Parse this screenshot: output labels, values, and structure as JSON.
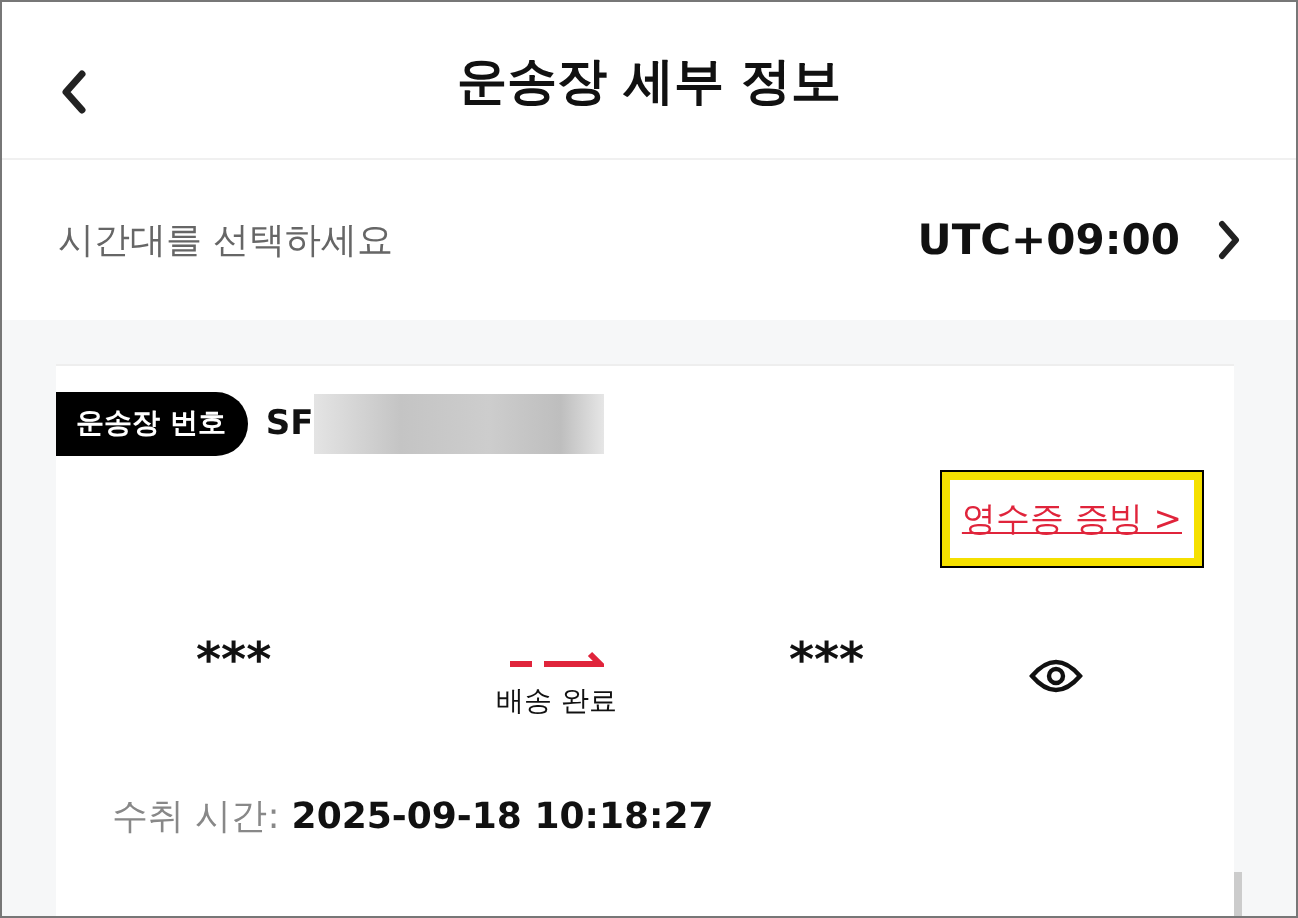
{
  "header": {
    "title": "운송장 세부 정보"
  },
  "timezone": {
    "label": "시간대를 선택하세요",
    "value": "UTC+09:00"
  },
  "waybill": {
    "badge": "운송장 번호",
    "number_prefix": "SF",
    "receipt_link": "영수증 증빙 >",
    "origin": "***",
    "destination": "***",
    "status": "배송 완료",
    "received_label": "수취 시간:",
    "received_time": "2025-09-18 10:18:27"
  }
}
